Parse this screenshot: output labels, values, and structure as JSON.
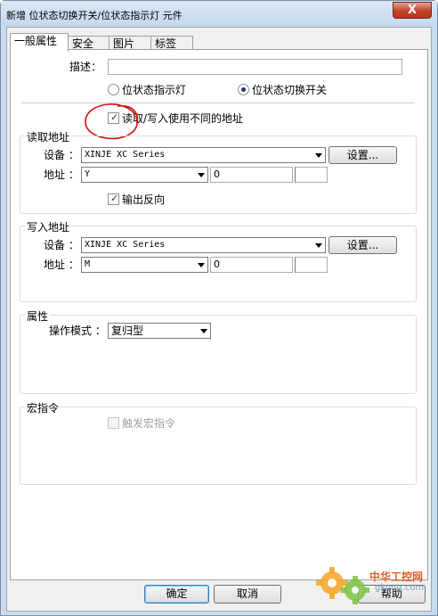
{
  "window": {
    "title": "新增 位状态切换开关/位状态指示灯 元件",
    "close_glyph": "X"
  },
  "tabs": [
    {
      "label": "一般属性"
    },
    {
      "label": "安全"
    },
    {
      "label": "图片"
    },
    {
      "label": "标签"
    }
  ],
  "general": {
    "description_label": "描述：",
    "description_value": "",
    "radio_indicator_label": "位状态指示灯",
    "radio_switch_label": "位状态切换开关",
    "radio_selected": "位状态切换开关",
    "separate_rw_label": "读取/写入使用不同的地址",
    "separate_rw_checked": true
  },
  "read_group": {
    "title": "读取地址",
    "device_label": "设备 ：",
    "device_value": "XINJE XC Series",
    "settings_button": "设置...",
    "address_label": "地址 ：",
    "address_type": "Y",
    "address_value": "0",
    "invert_label": "输出反向",
    "invert_checked": true
  },
  "write_group": {
    "title": "写入地址",
    "device_label": "设备 ：",
    "device_value": "XINJE XC Series",
    "settings_button": "设置...",
    "address_label": "地址 ：",
    "address_type": "M",
    "address_value": "0"
  },
  "attr_group": {
    "title": "属性",
    "mode_label": "操作模式 ：",
    "mode_value": "复归型"
  },
  "macro_group": {
    "title": "宏指令",
    "trigger_label": "触发宏指令",
    "trigger_checked": false
  },
  "buttons": {
    "ok": "确定",
    "cancel": "取消",
    "help": "帮助"
  },
  "watermark": {
    "site_cn": "中华工控网",
    "site_url": "gkong.com"
  },
  "colors": {
    "annotation": "#d01010",
    "accent": "#1b3a6b"
  }
}
